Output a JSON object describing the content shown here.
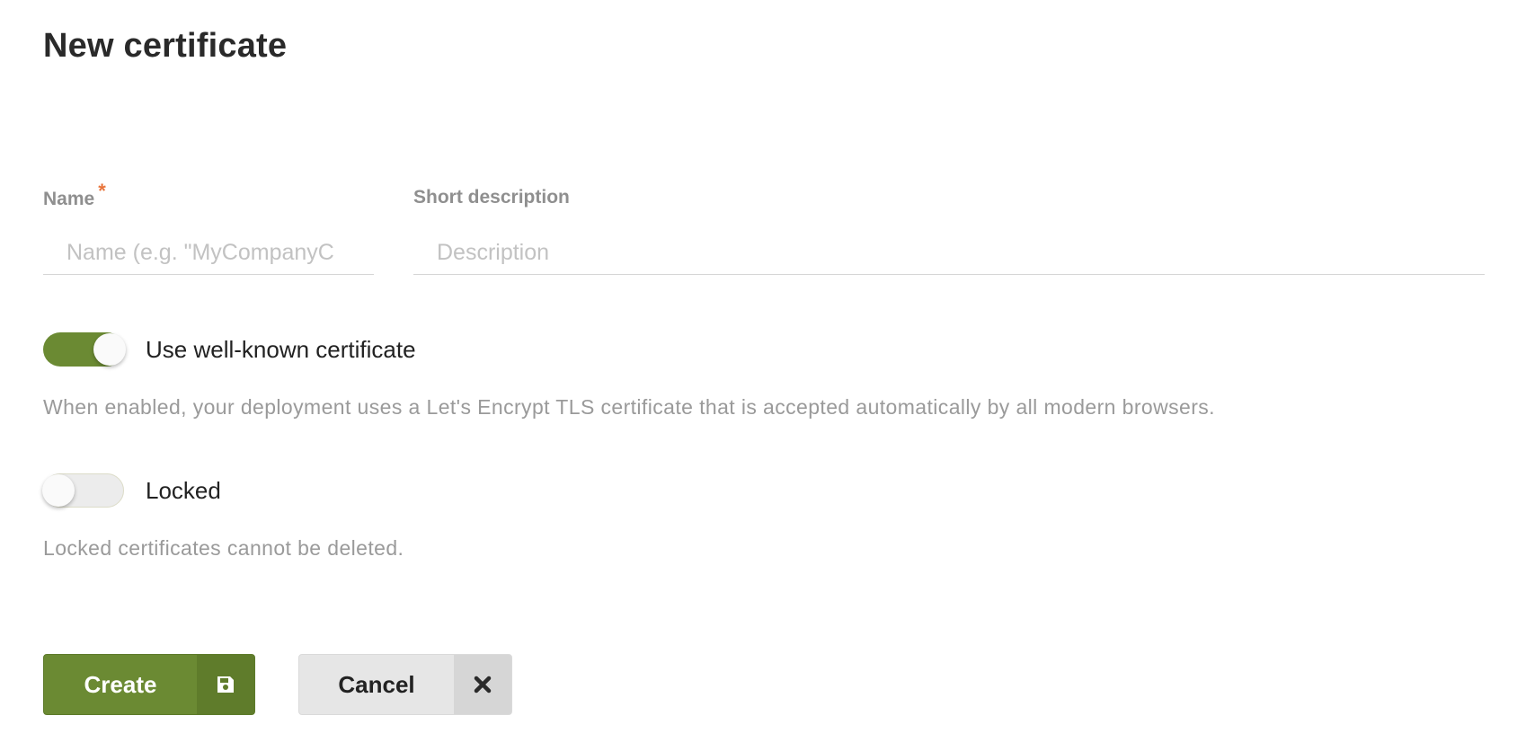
{
  "page": {
    "title": "New certificate"
  },
  "form": {
    "name": {
      "label": "Name",
      "required_mark": "*",
      "placeholder": "Name (e.g. \"MyCompanyC",
      "value": ""
    },
    "description": {
      "label": "Short description",
      "placeholder": "Description",
      "value": ""
    },
    "well_known": {
      "label": "Use well-known certificate",
      "enabled": true,
      "help": "When enabled, your deployment uses a Let's Encrypt TLS certificate that is accepted automatically by all modern browsers."
    },
    "locked": {
      "label": "Locked",
      "enabled": false,
      "help": "Locked certificates cannot be deleted."
    }
  },
  "actions": {
    "create_label": "Create",
    "create_icon": "save-icon",
    "cancel_label": "Cancel",
    "cancel_icon": "close-icon"
  },
  "colors": {
    "accent": "#6b8a33",
    "required": "#e8743b",
    "help_text": "#9a9a9a"
  }
}
